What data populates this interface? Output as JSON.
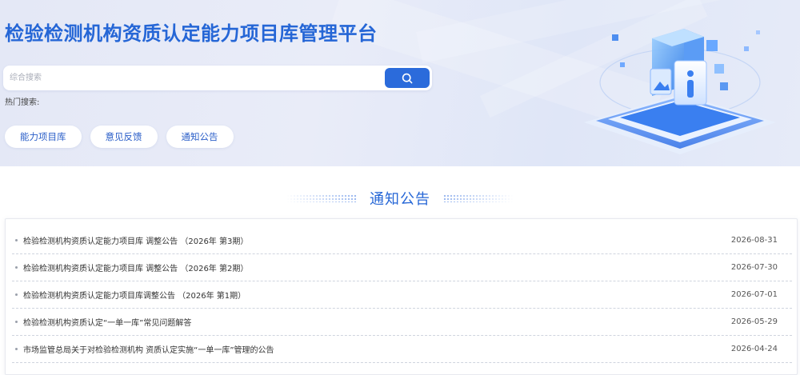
{
  "hero": {
    "title": "检验检测机构资质认定能力项目库管理平台",
    "search_placeholder": "综合搜索",
    "hot_label": "热门搜索:",
    "pills": [
      "能力项目库",
      "意见反馈",
      "通知公告"
    ]
  },
  "section": {
    "title": "通知公告"
  },
  "notices": [
    {
      "title": "检验检测机构资质认定能力项目库 调整公告 （2026年 第3期）",
      "date": "2026-08-31"
    },
    {
      "title": "检验检测机构资质认定能力项目库 调整公告 （2026年 第2期）",
      "date": "2026-07-30"
    },
    {
      "title": "检验检测机构资质认定能力项目库调整公告 （2026年 第1期）",
      "date": "2026-07-01"
    },
    {
      "title": "检验检测机构资质认定“一单一库”常见问题解答",
      "date": "2026-05-29"
    },
    {
      "title": "市场监管总局关于对检验检测机构 资质认定实施“一单一库”管理的公告",
      "date": "2026-04-24"
    }
  ],
  "colors": {
    "accent": "#2566d6",
    "button": "#2b6bdb"
  },
  "icons": {
    "search": "search-icon"
  }
}
